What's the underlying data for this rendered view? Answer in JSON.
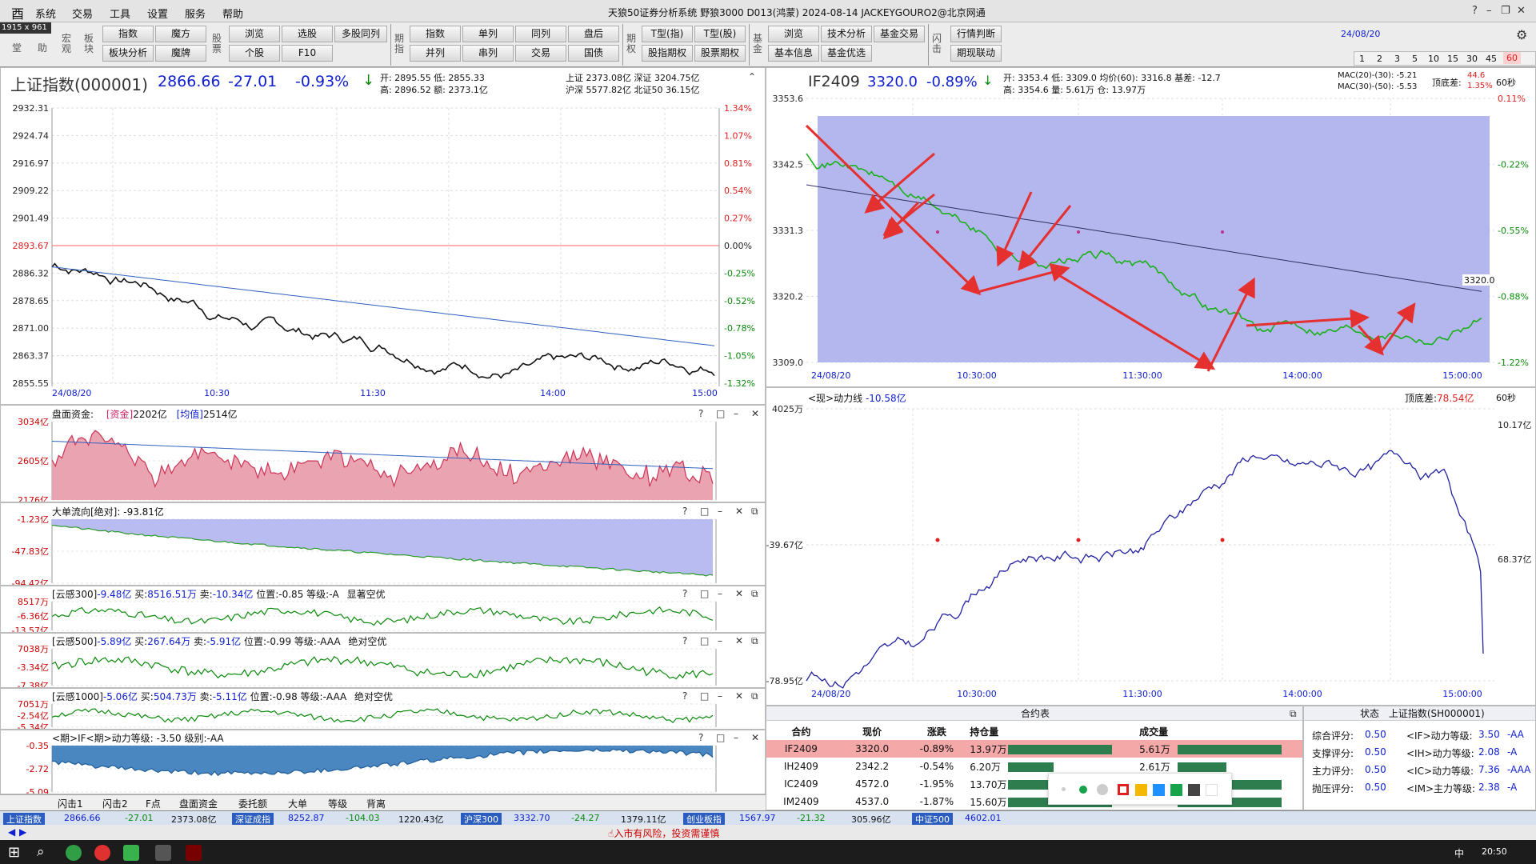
{
  "titlebar": {
    "menus": [
      "系统",
      "交易",
      "工具",
      "设置",
      "服务",
      "帮助"
    ],
    "title": "天狼50证券分析系统  野狼3000 D013(鸿蒙)  2024-08-14 JACKEYGOURO2@北京网通",
    "size_badge": "1915 x 961"
  },
  "toolbar": {
    "left_labels": [
      "堂",
      "助"
    ],
    "row1": [
      "指数",
      "魔方",
      "浏览",
      "选股",
      "多股同列",
      "指数",
      "单列",
      "同列",
      "盘后",
      "T型(指)",
      "T型(股)",
      "浏览",
      "技术分析",
      "基金交易",
      "行情判断"
    ],
    "row2": [
      "板块分析",
      "魔牌",
      "个股",
      "F10",
      "并列",
      "串列",
      "交易",
      "国债",
      "股指期权",
      "股票期权",
      "基本信息",
      "基金优选",
      "期现联动"
    ],
    "vlabels": [
      "宏观",
      "板块",
      "股票",
      "期指",
      "期权",
      "基金",
      "闪击"
    ],
    "period_tabs": [
      "1",
      "2",
      "3",
      "5",
      "10",
      "15",
      "30",
      "45",
      "60"
    ],
    "date_label": "24/08/20"
  },
  "left": {
    "name": "上证指数(000001)",
    "price": "2866.66",
    "change": "-27.01",
    "pct": "-0.93%",
    "stats1": "开: 2895.55  低: 2855.33",
    "stats2": "高: 2896.52  额: 2373.1亿",
    "stats3": "上证 2373.08亿  深证 3204.75亿",
    "stats4": "沪深 5577.82亿  北证50 36.15亿",
    "y_left": [
      "2932.31",
      "2924.74",
      "2916.97",
      "2909.22",
      "2901.49",
      "2893.67",
      "2886.32",
      "2878.65",
      "2871.00",
      "2863.37",
      "2855.55"
    ],
    "y_right": [
      "1.34%",
      "1.07%",
      "0.81%",
      "0.54%",
      "0.27%",
      "0.00%",
      "-0.25%",
      "-0.52%",
      "-0.78%",
      "-1.05%",
      "-1.32%"
    ],
    "x_labels": [
      "24/08/20",
      "10:30",
      "11:30",
      "14:00",
      "15:00"
    ]
  },
  "sub1": {
    "title": "盘面资金:",
    "t2": "[资金]",
    "v2": "2202亿",
    "t3": "[均值]",
    "v3": "2514亿",
    "y": [
      "3034亿",
      "2605亿",
      "2176亿"
    ]
  },
  "sub2": {
    "title": "大单流向[绝对]:",
    "v": "-93.81亿",
    "y": [
      "-1.23亿",
      "-47.83亿",
      "-94.42亿"
    ]
  },
  "sub3": {
    "title": "[云感300]",
    "v1": "-9.48亿",
    "b": "买:",
    "bv": "8516.51万",
    "s": "卖:",
    "sv": "-10.34亿",
    "p": "位置:",
    "pv": "-0.85",
    "g": "等级:",
    "gv": "-A",
    "tag": "显著空优",
    "y": [
      "8517万",
      "-6.36亿",
      "-13.57亿"
    ]
  },
  "sub4": {
    "title": "[云感500]",
    "v1": "-5.89亿",
    "b": "买:",
    "bv": "267.64万",
    "s": "卖:",
    "sv": "-5.91亿",
    "p": "位置:",
    "pv": "-0.99",
    "g": "等级:",
    "gv": "-AAA",
    "tag": "绝对空优",
    "y": [
      "7038万",
      "-3.34亿",
      "-7.38亿"
    ]
  },
  "sub5": {
    "title": "[云感1000]",
    "v1": "-5.06亿",
    "b": "买:",
    "bv": "504.73万",
    "s": "卖:",
    "sv": "-5.11亿",
    "p": "位置:",
    "pv": "-0.98",
    "g": "等级:",
    "gv": "-AAA",
    "tag": "绝对空优",
    "y": [
      "7051万",
      "-2.54亿",
      "-5.34亿"
    ]
  },
  "sub6": {
    "title": "<期>IF<期>动力等级:",
    "v": "-3.50",
    "g": "级别:",
    "gv": "-AA",
    "y": [
      "-0.35",
      "-2.72",
      "-5.09"
    ]
  },
  "left_tabs": [
    "闪击1",
    "闪击2",
    "F点",
    "盘面资金",
    "委托额",
    "大单",
    "等级",
    "背离"
  ],
  "right": {
    "name": "IF2409",
    "price": "3320.0",
    "pct": "-0.89%",
    "stats1": "开: 3353.4  低: 3309.0  均价(60): 3316.8  基差: -12.7",
    "stats2": "高: 3354.6  量: 5.61万  仓: 13.97万",
    "mac1": "MAC(20)-(30): -5.21",
    "mac2": "MAC(30)-(50): -5.53",
    "dd": "顶底差:",
    "ddv": "44.6",
    "ddp": "1.35%",
    "period": "60秒",
    "y_left": [
      "3353.6",
      "3342.5",
      "3331.3",
      "3320.2",
      "3309.0"
    ],
    "y_right": [
      "0.11%",
      "-0.22%",
      "-0.55%",
      "-0.88%",
      "-1.22%"
    ],
    "price_tag": "3320.0",
    "x_labels": [
      "24/08/20",
      "10:30:00",
      "11:30:00",
      "14:00:00",
      "15:00:00"
    ]
  },
  "right2": {
    "title": "<现>动力线",
    "v": "-10.58亿",
    "dd": "顶底差:",
    "ddv": "78.54亿",
    "period": "60秒",
    "y_left": [
      "4025万",
      "-39.67亿",
      "-78.95亿"
    ],
    "y_right": [
      "10.17亿",
      "68.37亿"
    ],
    "x_labels": [
      "24/08/20",
      "10:30:00",
      "11:30:00",
      "14:00:00",
      "15:00:00"
    ]
  },
  "contracts": {
    "caption": "合约表",
    "headers": [
      "合约",
      "现价",
      "涨跌",
      "持仓量",
      "成交量"
    ],
    "rows": [
      {
        "c": "IF2409",
        "p": "3320.0",
        "ch": "-0.89%",
        "oi": "13.97万",
        "vol": "5.61万",
        "oib": 1.0,
        "vb": 1.0
      },
      {
        "c": "IH2409",
        "p": "2342.2",
        "ch": "-0.54%",
        "oi": "6.20万",
        "vol": "2.61万",
        "oib": 0.44,
        "vb": 0.47
      },
      {
        "c": "IC2409",
        "p": "4572.0",
        "ch": "-1.95%",
        "oi": "13.70万",
        "vol": "",
        "oib": 0.98,
        "vb": 1.0
      },
      {
        "c": "IM2409",
        "p": "4537.0",
        "ch": "-1.87%",
        "oi": "15.60万",
        "vol": "",
        "oib": 1.0,
        "vb": 1.0
      }
    ]
  },
  "status_panel": {
    "caption1": "状态",
    "caption2": "上证指数(SH000001)",
    "rows": [
      {
        "k": "综合评分:",
        "v": "0.50",
        "k2": "<IF>动力等级:",
        "v2": "3.50",
        "t2": "-AA"
      },
      {
        "k": "支撑评分:",
        "v": "0.50",
        "k2": "<IH>动力等级:",
        "v2": "2.08",
        "t2": "-A"
      },
      {
        "k": "主力评分:",
        "v": "0.50",
        "k2": "<IC>动力等级:",
        "v2": "7.36",
        "t2": "-AAA"
      },
      {
        "k": "抛压评分:",
        "v": "0.50",
        "k2": "<IM>主力等级:",
        "v2": "2.38",
        "t2": "-A"
      }
    ]
  },
  "statusbar": {
    "items": [
      "上证指数",
      "2866.66",
      "-27.01",
      "2373.08亿",
      "深证成指",
      "8252.87",
      "-104.03",
      "1220.43亿",
      "沪深300",
      "3332.70",
      "-24.27",
      "1379.11亿",
      "创业板指",
      "1567.97",
      "-21.32",
      "305.96亿",
      "中证500",
      "4602.01"
    ]
  },
  "ticker": "入市有风险，投资需谨慎",
  "colors": {
    "accent": "#1020d0",
    "up": "#e02020",
    "down": "#0a8a0a",
    "fill": "#b8bcf0"
  }
}
